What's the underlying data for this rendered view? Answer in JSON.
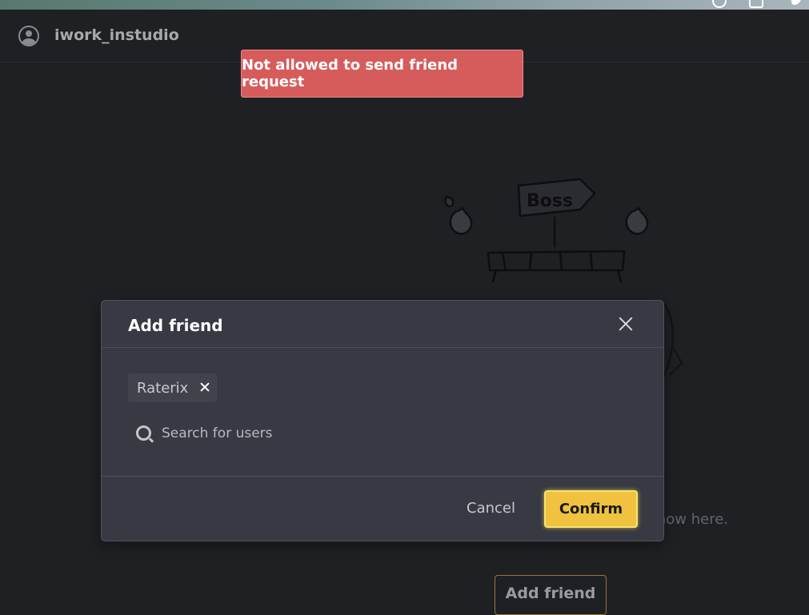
{
  "topbar": {
    "username": "iwork_instudio"
  },
  "toast": {
    "message": "Not allowed to send friend request"
  },
  "illustration": {
    "sign_text": "Boss"
  },
  "background": {
    "empty_text": "end, all your friends will show here.",
    "add_friend_label": "Add friend"
  },
  "modal": {
    "title": "Add friend",
    "chip_label": "Raterix",
    "search": {
      "placeholder": "Search for users",
      "value": ""
    },
    "cancel_label": "Cancel",
    "confirm_label": "Confirm"
  },
  "colors": {
    "background": "#1f2024",
    "modal": "#373943",
    "toast": "#d65c5c",
    "confirm": "#f0c23f"
  },
  "icons": [
    "user-avatar-icon",
    "close-icon",
    "remove-chip-icon",
    "search-icon"
  ]
}
